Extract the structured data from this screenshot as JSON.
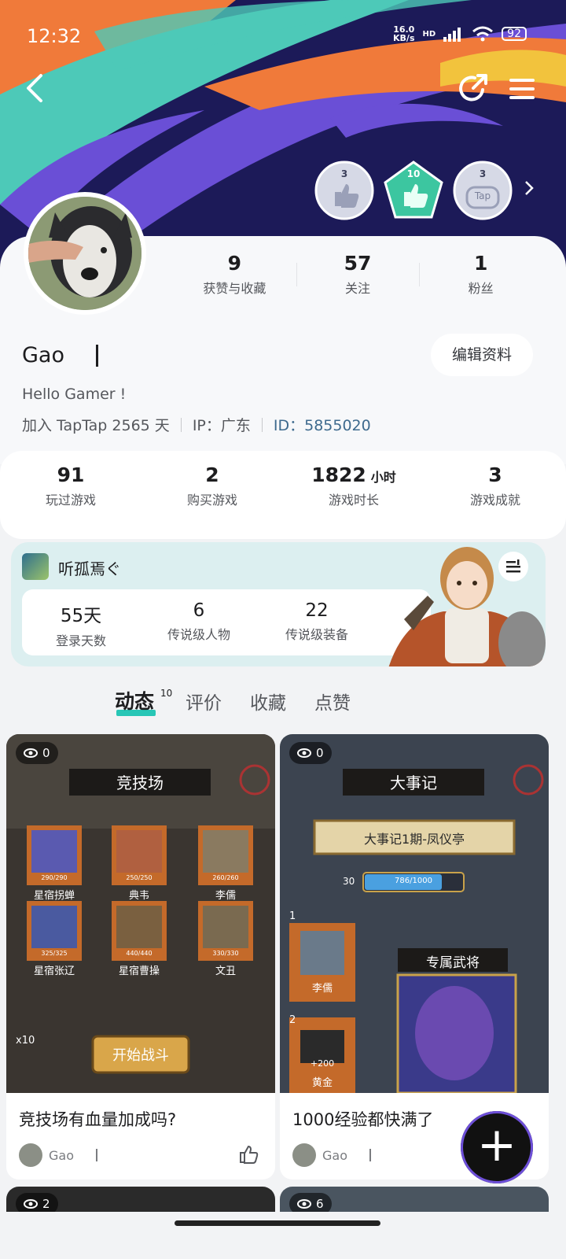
{
  "status_bar": {
    "time": "12:32",
    "net_speed_value": "16.0",
    "net_speed_unit": "KB/s",
    "signal_tag": "HD",
    "battery": "92"
  },
  "header": {
    "badges": [
      {
        "count": "3",
        "color": "#c4c9dc"
      },
      {
        "count": "10",
        "color": "#3cc6a0"
      },
      {
        "count": "3",
        "color": "#c4c9dc",
        "label": "Tap"
      }
    ]
  },
  "profile": {
    "stats": [
      {
        "value": "9",
        "label": "获赞与收藏"
      },
      {
        "value": "57",
        "label": "关注"
      },
      {
        "value": "1",
        "label": "粉丝"
      }
    ],
    "name": "Gao",
    "edit_button": "编辑资料",
    "bio": "Hello Gamer !",
    "joined": "加入 TapTap 2565 天",
    "ip": "IP：广东",
    "id": "ID：5855020"
  },
  "game_stats": [
    {
      "value": "91",
      "unit": "",
      "label": "玩过游戏"
    },
    {
      "value": "2",
      "unit": "",
      "label": "购买游戏"
    },
    {
      "value": "1822",
      "unit": "小时",
      "label": "游戏时长"
    },
    {
      "value": "3",
      "unit": "",
      "label": "游戏成就"
    }
  ],
  "game_card": {
    "name": "听孤焉ぐ",
    "stats": [
      {
        "value": "55天",
        "label": "登录天数"
      },
      {
        "value": "6",
        "label": "传说级人物"
      },
      {
        "value": "22",
        "label": "传说级装备"
      }
    ]
  },
  "tabs": [
    {
      "label": "动态",
      "count": "10",
      "active": true
    },
    {
      "label": "评价"
    },
    {
      "label": "收藏"
    },
    {
      "label": "点赞"
    }
  ],
  "posts": [
    {
      "views": "0",
      "title": "竞技场有血量加成吗?",
      "author": "Gao",
      "image_texts": {
        "header": "竞技场",
        "names": [
          "星宿拐蝉",
          "典韦",
          "李儒",
          "星宿张辽",
          "星宿曹操",
          "文丑"
        ],
        "hp": [
          "290/290",
          "250/250",
          "260/260",
          "325/325",
          "440/440",
          "330/330"
        ],
        "start": "开始战斗",
        "multiplier": "x10"
      }
    },
    {
      "views": "0",
      "title": "1000经验都快满了",
      "author": "Gao",
      "image_texts": {
        "header": "大事记",
        "subtitle": "大事记1期-凤仪亭",
        "level": "30",
        "progress": "786/1000",
        "exclusive": "专属武将",
        "hero": "李儒",
        "reward": "+200",
        "reward_name": "黄金",
        "steps": [
          "1",
          "2"
        ]
      }
    }
  ],
  "more_posts": [
    {
      "views": "2"
    },
    {
      "views": "6"
    }
  ],
  "fab": {
    "label": "+"
  }
}
